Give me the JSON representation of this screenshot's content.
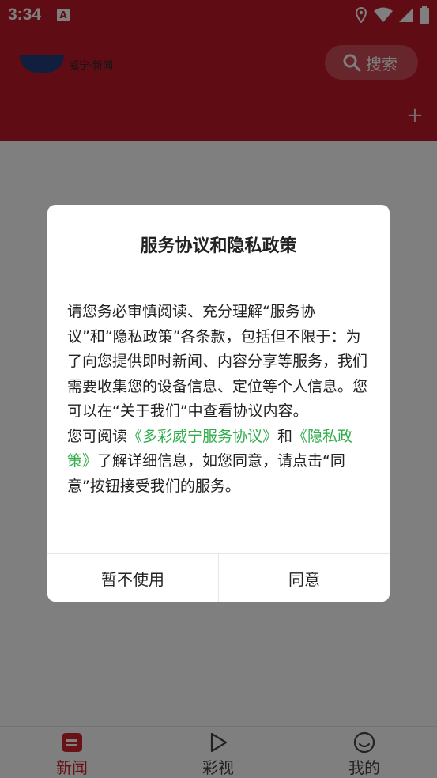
{
  "status_bar": {
    "time": "3:34",
    "notification_icon_letter": "A"
  },
  "header": {
    "search_label": "搜索",
    "logo_text": "威宁·新闻"
  },
  "tabs": [
    {
      "label": "新闻",
      "icon": "news-icon",
      "active": true
    },
    {
      "label": "彩视",
      "icon": "play-icon",
      "active": false
    },
    {
      "label": "我的",
      "icon": "smiley-icon",
      "active": false
    }
  ],
  "dialog": {
    "title": "服务协议和隐私政策",
    "para1": "请您务必审慎阅读、充分理解“服务协议”和“隐私政策”各条款，包括但不限于：为了向您提供即时新闻、内容分享等服务，我们需要收集您的设备信息、定位等个人信息。您可以在“关于我们”中查看协议内容。",
    "para2_prefix": "您可阅读",
    "link_service": "《多彩威宁服务协议》",
    "para2_and": "和",
    "link_privacy": "《隐私政策》",
    "para2_suffix": "了解详细信息，如您同意，请点击“同意”按钮接受我们的服务。",
    "decline_label": "暂不使用",
    "agree_label": "同意"
  },
  "colors": {
    "brand_red": "#c0182a",
    "link_green": "#2eae4a",
    "active_tab": "#d4232d"
  }
}
